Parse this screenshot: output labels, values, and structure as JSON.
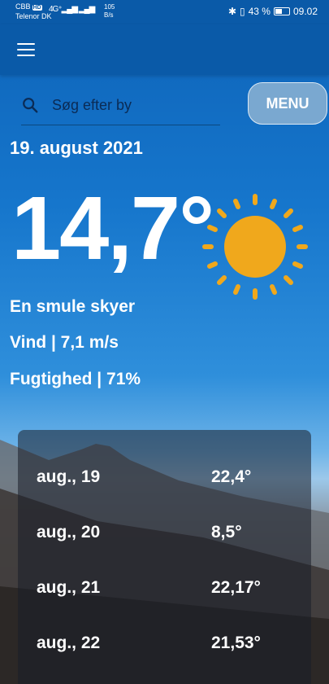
{
  "status_bar": {
    "carrier_top": "CBB",
    "hd_badge": "HD",
    "carrier_bottom": "Telenor DK",
    "signal": "4G⁺▂▄▆  ▂▄▆",
    "speed_value": "105",
    "speed_unit": "B/s",
    "battery_text": "43 %",
    "time": "09.02"
  },
  "search": {
    "placeholder": "Søg efter by"
  },
  "menu_button": "MENU",
  "weather": {
    "date": "19. august 2021",
    "temperature": "14,7°",
    "description": "En smule skyer",
    "wind": "Vind | 7,1 m/s",
    "humidity": "Fugtighed | 71%"
  },
  "forecast": [
    {
      "date": "aug., 19",
      "temp": "22,4°"
    },
    {
      "date": "aug., 20",
      "temp": "8,5°"
    },
    {
      "date": "aug., 21",
      "temp": "22,17°"
    },
    {
      "date": "aug., 22",
      "temp": "21,53°"
    }
  ],
  "colors": {
    "app_bar": "#0a5aa8",
    "sun": "#f0a81c",
    "menu_button": "#7aa8d0"
  },
  "icons": {
    "menu": "hamburger-icon",
    "search": "search-icon",
    "weather": "sun-icon"
  }
}
